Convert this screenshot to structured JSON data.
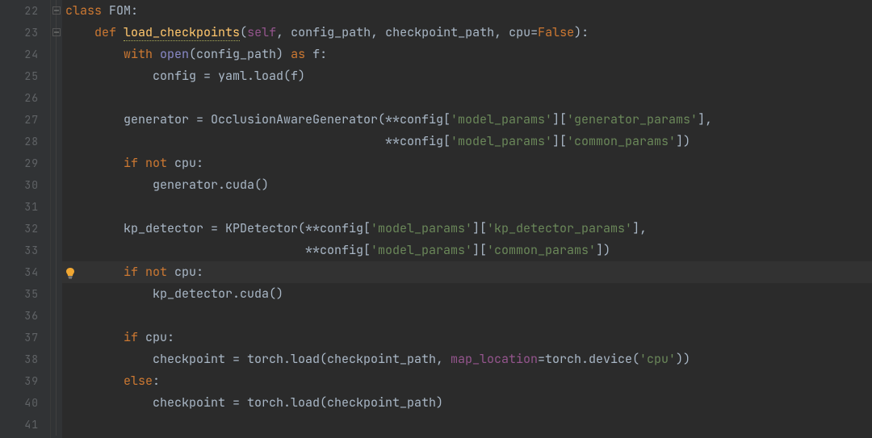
{
  "gutter": {
    "start": 22,
    "end": 41,
    "caret": 34,
    "bulb_line": 34,
    "fold_markers": [
      22,
      23
    ]
  },
  "code": {
    "lines": [
      [
        {
          "c": "kw",
          "t": "class "
        },
        {
          "c": "txt",
          "t": "FOM:"
        }
      ],
      [
        {
          "c": "txt",
          "t": "    "
        },
        {
          "c": "kw",
          "t": "def "
        },
        {
          "c": "defname",
          "t": "load_checkpoints"
        },
        {
          "c": "txt",
          "t": "("
        },
        {
          "c": "self",
          "t": "self"
        },
        {
          "c": "txt",
          "t": ", config_path, checkpoint_path, cpu="
        },
        {
          "c": "const",
          "t": "False"
        },
        {
          "c": "txt",
          "t": "):"
        }
      ],
      [
        {
          "c": "txt",
          "t": "        "
        },
        {
          "c": "kw",
          "t": "with "
        },
        {
          "c": "bi",
          "t": "open"
        },
        {
          "c": "txt",
          "t": "(config_path) "
        },
        {
          "c": "kw",
          "t": "as "
        },
        {
          "c": "txt",
          "t": "f:"
        }
      ],
      [
        {
          "c": "txt",
          "t": "            config = yaml.load(f)"
        }
      ],
      [
        {
          "c": "txt",
          "t": ""
        }
      ],
      [
        {
          "c": "txt",
          "t": "        generator = OcclusionAwareGenerator(**config["
        },
        {
          "c": "str",
          "t": "'model_params'"
        },
        {
          "c": "txt",
          "t": "]["
        },
        {
          "c": "str",
          "t": "'generator_params'"
        },
        {
          "c": "txt",
          "t": "],"
        }
      ],
      [
        {
          "c": "txt",
          "t": "                                            **config["
        },
        {
          "c": "str",
          "t": "'model_params'"
        },
        {
          "c": "txt",
          "t": "]["
        },
        {
          "c": "str",
          "t": "'common_params'"
        },
        {
          "c": "txt",
          "t": "])"
        }
      ],
      [
        {
          "c": "txt",
          "t": "        "
        },
        {
          "c": "kw",
          "t": "if not "
        },
        {
          "c": "txt",
          "t": "cpu:"
        }
      ],
      [
        {
          "c": "txt",
          "t": "            generator.cuda()"
        }
      ],
      [
        {
          "c": "txt",
          "t": ""
        }
      ],
      [
        {
          "c": "txt",
          "t": "        kp_detector = KPDetector(**config["
        },
        {
          "c": "str",
          "t": "'model_params'"
        },
        {
          "c": "txt",
          "t": "]["
        },
        {
          "c": "str",
          "t": "'kp_detector_params'"
        },
        {
          "c": "txt",
          "t": "],"
        }
      ],
      [
        {
          "c": "txt",
          "t": "                                 **config["
        },
        {
          "c": "str",
          "t": "'model_params'"
        },
        {
          "c": "txt",
          "t": "]["
        },
        {
          "c": "str",
          "t": "'common_params'"
        },
        {
          "c": "txt",
          "t": "])"
        }
      ],
      [
        {
          "c": "txt",
          "t": "        "
        },
        {
          "c": "kw",
          "t": "if not "
        },
        {
          "c": "txt",
          "t": "cpu:"
        }
      ],
      [
        {
          "c": "txt",
          "t": "            kp_detector.cuda()"
        }
      ],
      [
        {
          "c": "txt",
          "t": ""
        }
      ],
      [
        {
          "c": "txt",
          "t": "        "
        },
        {
          "c": "kw",
          "t": "if "
        },
        {
          "c": "txt",
          "t": "cpu:"
        }
      ],
      [
        {
          "c": "txt",
          "t": "            checkpoint = torch.load(checkpoint_path, "
        },
        {
          "c": "kwname",
          "t": "map_location"
        },
        {
          "c": "txt",
          "t": "=torch.device("
        },
        {
          "c": "str",
          "t": "'cpu'"
        },
        {
          "c": "txt",
          "t": "))"
        }
      ],
      [
        {
          "c": "txt",
          "t": "        "
        },
        {
          "c": "kw",
          "t": "else"
        },
        {
          "c": "txt",
          "t": ":"
        }
      ],
      [
        {
          "c": "txt",
          "t": "            checkpoint = torch.load(checkpoint_path)"
        }
      ],
      [
        {
          "c": "txt",
          "t": ""
        }
      ]
    ]
  }
}
